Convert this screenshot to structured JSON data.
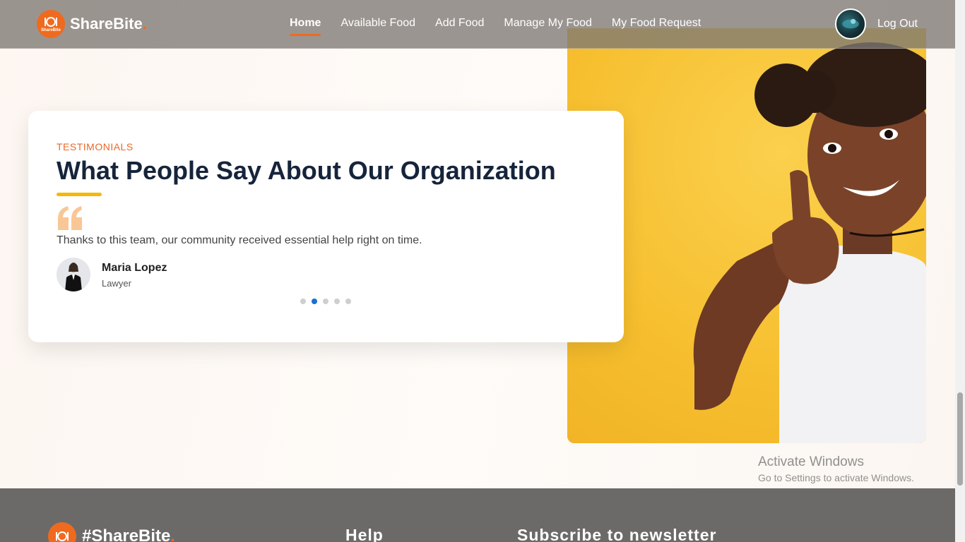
{
  "brand": {
    "name": "ShareBite",
    "dot": ".",
    "logo_small_text": "ShareBite"
  },
  "nav": {
    "items": [
      {
        "label": "Home",
        "active": true
      },
      {
        "label": "Available Food",
        "active": false
      },
      {
        "label": "Add Food",
        "active": false
      },
      {
        "label": "Manage My Food",
        "active": false
      },
      {
        "label": "My Food Request",
        "active": false
      }
    ],
    "logout_label": "Log Out"
  },
  "testimonials": {
    "eyebrow": "TESTIMONIALS",
    "heading": "What People Say About Our Organization",
    "quote": "Thanks to this team, our community received essential help right on time.",
    "person_name": "Maria Lopez",
    "person_role": "Lawyer",
    "slide_count": 5,
    "active_slide": 2
  },
  "watermark": {
    "title": "Activate Windows",
    "subtitle": "Go to Settings to activate Windows."
  },
  "footer": {
    "brand_name": "#ShareBite",
    "dot": ".",
    "help_heading": "Help",
    "subscribe_heading": "Subscribe to newsletter"
  },
  "colors": {
    "accent": "#ef6a1f",
    "heading": "#16243b",
    "underline": "#f5b800",
    "active_dot": "#1a6fd8",
    "photo_bg": "#f7c236"
  }
}
